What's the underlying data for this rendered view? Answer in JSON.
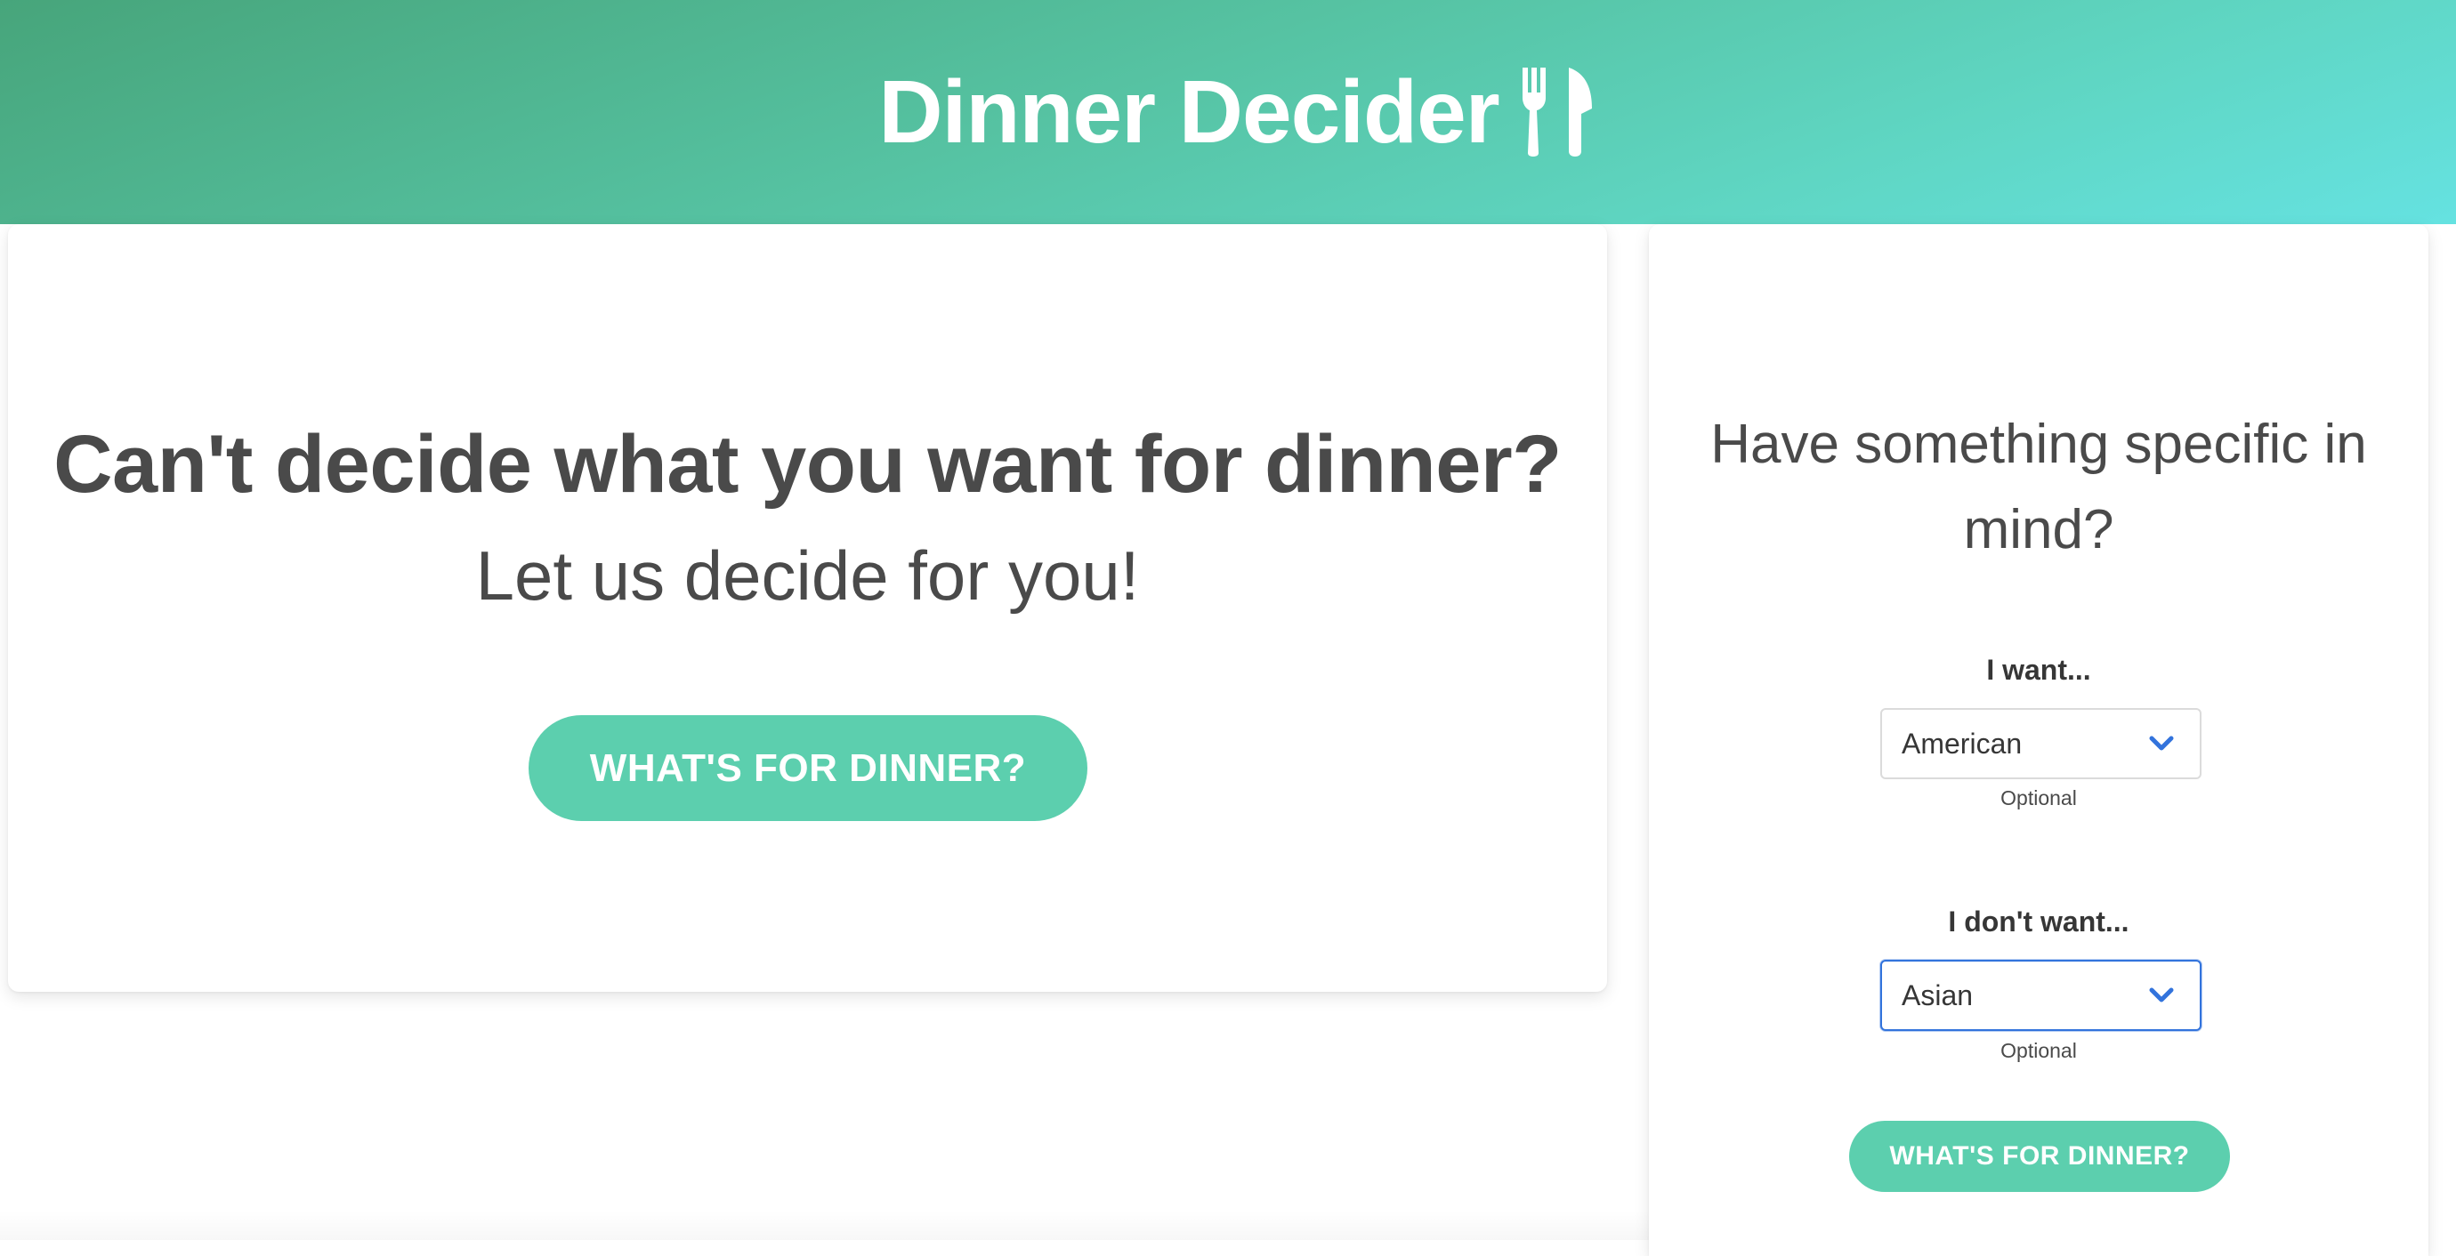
{
  "header": {
    "title": "Dinner Decider",
    "icon": "utensils-icon",
    "gradient": [
      "#47a57b",
      "#65e2e1"
    ]
  },
  "hero": {
    "title": "Can't decide what you want for dinner?",
    "subtitle": "Let us decide for you!",
    "button_label": "WHAT'S FOR DINNER?"
  },
  "filters": {
    "title": "Have something specific in mind?",
    "want": {
      "label": "I want...",
      "selected": "American",
      "help": "Optional"
    },
    "dont_want": {
      "label": "I don't want...",
      "selected": "Asian",
      "help": "Optional"
    },
    "button_label": "WHAT'S FOR DINNER?"
  },
  "colors": {
    "accent": "#5ccfae",
    "focus": "#3273dc",
    "text": "#4a4a4a"
  }
}
